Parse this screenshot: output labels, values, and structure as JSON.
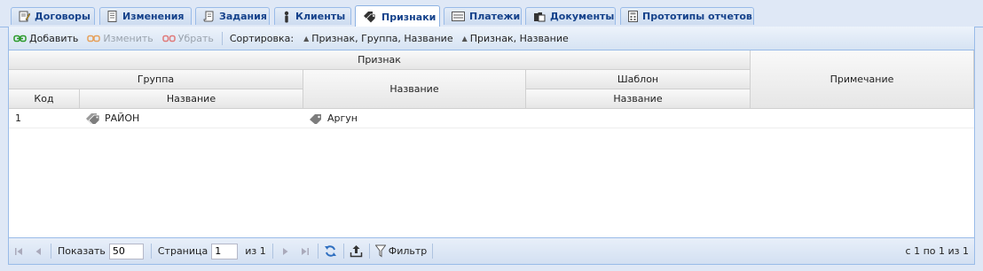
{
  "tabs": [
    {
      "label": "Договоры",
      "icon": "pencil-document-icon",
      "active": false
    },
    {
      "label": "Изменения",
      "icon": "document-icon",
      "active": false
    },
    {
      "label": "Задания",
      "icon": "scroll-icon",
      "active": false
    },
    {
      "label": "Клиенты",
      "icon": "person-icon",
      "active": false
    },
    {
      "label": "Признаки",
      "icon": "tags-icon",
      "active": true
    },
    {
      "label": "Платежи",
      "icon": "card-icon",
      "active": false
    },
    {
      "label": "Документы",
      "icon": "folder-document-icon",
      "active": false
    },
    {
      "label": "Прототипы отчетов",
      "icon": "calculator-icon",
      "active": false
    }
  ],
  "toolbar": {
    "add_label": "Добавить",
    "edit_label": "Изменить",
    "remove_label": "Убрать",
    "sort_label": "Сортировка:",
    "sort_options": [
      "Признак, Группа, Название",
      "Признак, Название"
    ]
  },
  "grid": {
    "headers": {
      "priznak": "Признак",
      "gruppa": "Группа",
      "kod": "Код",
      "gruppa_nazvanie": "Название",
      "nazvanie": "Название",
      "shablon": "Шаблон",
      "shablon_nazvanie": "Название",
      "primechanie": "Примечание"
    },
    "rows": [
      {
        "kod": "1",
        "gruppa_nazvanie": "РАЙОН",
        "nazvanie": "Аргун",
        "shablon_nazvanie": "",
        "primechanie": ""
      }
    ]
  },
  "pager": {
    "show_label": "Показать",
    "page_size": "50",
    "page_label": "Страница",
    "page": "1",
    "of_label": "из 1",
    "filter_label": "Фильтр",
    "info": "с 1 по 1 из 1"
  },
  "colors": {
    "accent": "#15428b",
    "border": "#99bbe8",
    "background": "#dfe8f6"
  }
}
